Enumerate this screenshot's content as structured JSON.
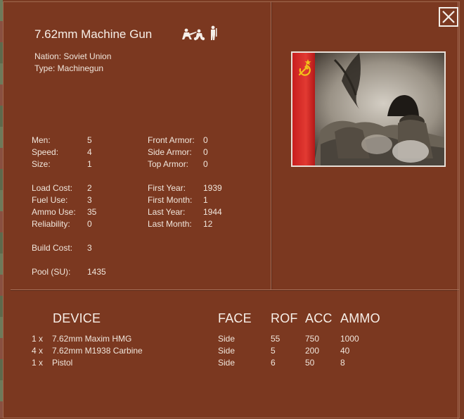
{
  "unit": {
    "title": "7.62mm Machine Gun",
    "nation_line": "Nation: Soviet Union",
    "type_line": "Type: Machinegun",
    "crew_icon": "machine-gun-crew-icon"
  },
  "stats_left": [
    {
      "label": "Men:",
      "value": "5"
    },
    {
      "label": "Speed:",
      "value": "4"
    },
    {
      "label": "Size:",
      "value": "1"
    },
    {
      "label": "Load Cost:",
      "value": "2"
    },
    {
      "label": "Fuel Use:",
      "value": "3"
    },
    {
      "label": "Ammo Use:",
      "value": "35"
    },
    {
      "label": "Reliability:",
      "value": "0"
    },
    {
      "label": "Build Cost:",
      "value": "3"
    },
    {
      "label": "Pool (SU):",
      "value": "1435"
    }
  ],
  "stats_right": [
    {
      "label": "Front Armor:",
      "value": "0"
    },
    {
      "label": "Side Armor:",
      "value": "0"
    },
    {
      "label": "Top Armor:",
      "value": "0"
    },
    {
      "label": "First Year:",
      "value": "1939"
    },
    {
      "label": "First Month:",
      "value": "1"
    },
    {
      "label": "Last Year:",
      "value": "1944"
    },
    {
      "label": "Last Month:",
      "value": "12"
    }
  ],
  "devices": {
    "headers": {
      "device": "DEVICE",
      "face": "FACE",
      "rof": "ROF",
      "acc": "ACC",
      "ammo": "AMMO"
    },
    "rows": [
      {
        "qty": "1 x",
        "name": "7.62mm Maxim HMG",
        "face": "Side",
        "rof": "55",
        "acc": "750",
        "ammo": "1000"
      },
      {
        "qty": "4 x",
        "name": "7.62mm M1938 Carbine",
        "face": "Side",
        "rof": "5",
        "acc": "200",
        "ammo": "40"
      },
      {
        "qty": "1 x",
        "name": "Pistol",
        "face": "Side",
        "rof": "6",
        "acc": "50",
        "ammo": "8"
      }
    ]
  },
  "image": {
    "flag_icon": "hammer-sickle-icon"
  },
  "close_icon": "close-icon",
  "colors": {
    "background": "#7b3820",
    "text": "#f0e6dc",
    "flag_red": "#d42a26",
    "flag_gold": "#f2c21a"
  }
}
